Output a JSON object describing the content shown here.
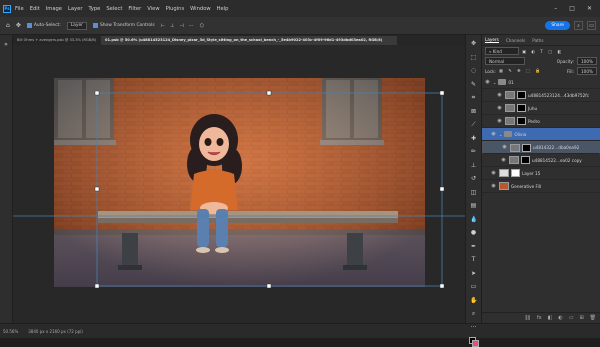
{
  "menubar": {
    "items": [
      "File",
      "Edit",
      "Image",
      "Layer",
      "Type",
      "Select",
      "Filter",
      "View",
      "Plugins",
      "Window",
      "Help"
    ],
    "app_icon": "Ps"
  },
  "options": {
    "auto_select": "Auto-Select:",
    "auto_select_value": "Layer",
    "transform_controls": "Show Transform Controls",
    "share": "Share"
  },
  "tabs": [
    "Bill Ohms + avengers.psb @ 33.3% (RGB/8)",
    "01.psb @ 50.6% (u48814523124_Disney_pixar_3d_Style_sitting_on_the_school_bench_-_5e4b9022-403c-4f09-96d1-493dbd03ea02, RGB/8)"
  ],
  "status": {
    "zoom": "50.56%",
    "size": "3840 px x 2160 px (72 ppi)"
  },
  "panel": {
    "tabs": [
      "Layers",
      "Channels",
      "Paths"
    ],
    "filter_label": "Kind",
    "blend_mode": "Normal",
    "opacity_label": "Opacity:",
    "opacity_value": "100%",
    "lock_label": "Lock:",
    "fill_label": "Fill:",
    "fill_value": "100%",
    "layers": [
      {
        "name": "01",
        "kind": "group"
      },
      {
        "name": "u48814523124...43db9752fc",
        "kind": "layer"
      },
      {
        "name": "Juhu",
        "kind": "layer"
      },
      {
        "name": "Pedro",
        "kind": "layer"
      },
      {
        "name": "Olivia",
        "kind": "group"
      },
      {
        "name": "u4814322...dba0ea92",
        "kind": "layer"
      },
      {
        "name": "u48814522...ea02 copy",
        "kind": "layer"
      },
      {
        "name": "Layer 15",
        "kind": "layer"
      },
      {
        "name": "Generative Fill",
        "kind": "layer"
      }
    ]
  },
  "colors": {
    "accent": "#1473e6",
    "selection": "#3d6ab0",
    "guide": "#4a7fb0",
    "brick": "#b5552f"
  }
}
